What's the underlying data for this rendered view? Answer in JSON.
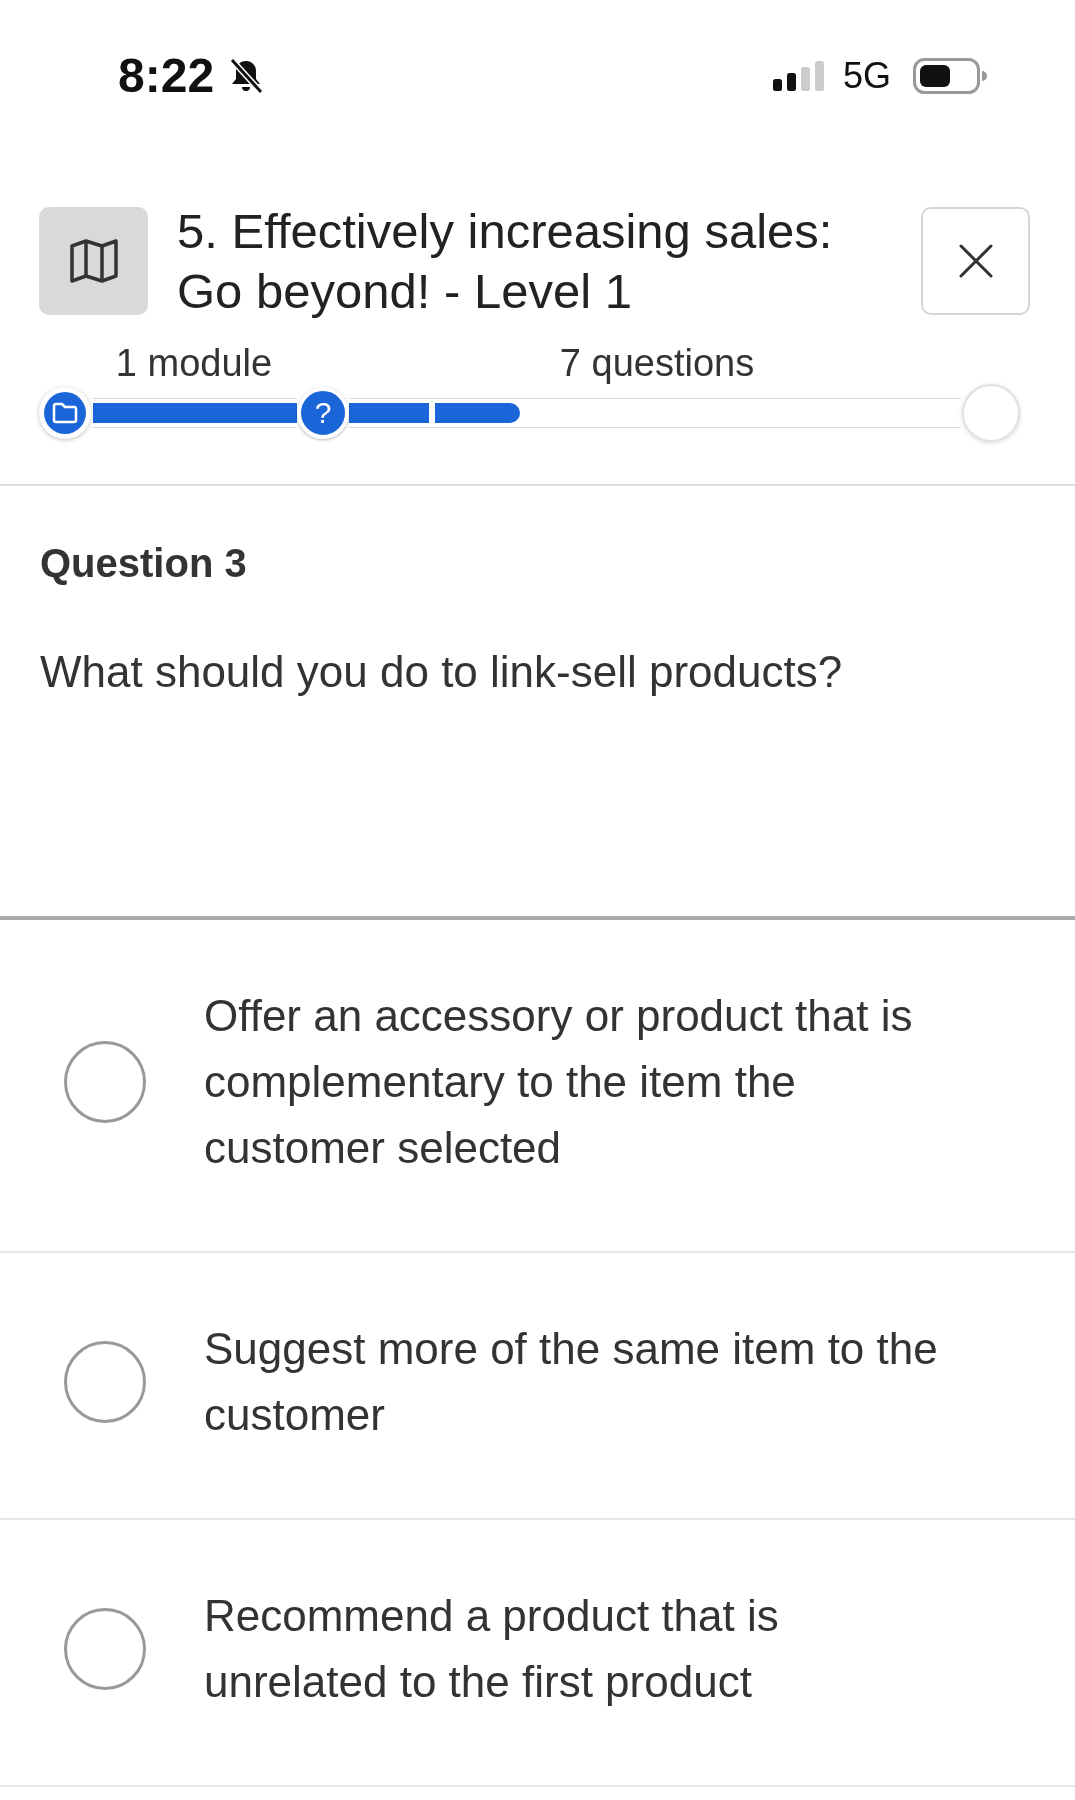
{
  "status_bar": {
    "time": "8:22",
    "silent": true,
    "network": "5G"
  },
  "course": {
    "title": "5. Effectively increasing sales: Go beyond! - Level 1"
  },
  "progress": {
    "sections": [
      {
        "kind": "module",
        "label": "1 module",
        "level": 1
      },
      {
        "kind": "questions",
        "label": "7 questions",
        "level": 0.28,
        "marker": "?"
      }
    ]
  },
  "question": {
    "heading": "Question 3",
    "text": "What should you do to link-sell products?"
  },
  "options": [
    {
      "text": "Offer an accessory or product that is complementary to the item the customer selected",
      "selected": false
    },
    {
      "text": "Suggest more of the same item to the customer",
      "selected": false
    },
    {
      "text": "Recommend a product that is unrelated to the first product",
      "selected": false
    }
  ]
}
